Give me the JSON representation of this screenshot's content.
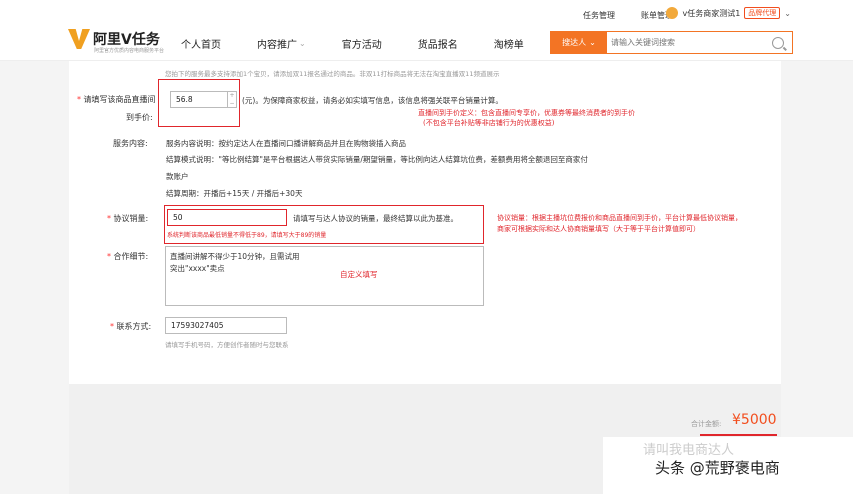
{
  "topbar": {
    "task_mgmt": "任务管理",
    "bill_mgmt": "账单管理",
    "user_name": "v任务商家测试1",
    "brand_badge": "品牌代理"
  },
  "logo": {
    "text": "阿里V任务",
    "sub": "阿里官方优质内容电商服务平台"
  },
  "nav": [
    "个人首页",
    "内容推广",
    "官方活动",
    "货品报名",
    "淘榜单"
  ],
  "search": {
    "select_label": "搜达人",
    "placeholder": "请输入关键词搜索"
  },
  "form": {
    "top_note": "您拍下的服务最多支持添加1个宝贝，请添加双11报名通过的商品。非双11打标商品将无法在淘宝直播双11频道展示",
    "price": {
      "label_line1": "请填写该商品直播间",
      "label_line2": "到手价:",
      "value": "56.8",
      "hint": "(元)。为保障商家权益，请务必如实填写信息，该信息将强关联平台销量计算。",
      "annotation_line1": "直播间到手价定义：包含直播间专享价，优惠券等最终消费者的到手价",
      "annotation_line2": "(不包含平台补贴等非店铺行为的优惠权益)"
    },
    "service": {
      "label": "服务内容:",
      "line1": "服务内容说明：按约定达人在直播间口播讲解商品并且在购物袋插入商品",
      "line2": "结算模式说明：\"等比例结算\"是平台根据达人带货实际销量/期望销量，等比例向达人结算坑位费，差额费用将全额退回至商家付",
      "line3": "款账户",
      "line4": "结算周期：开播后+15天 / 开播后+30天"
    },
    "sales": {
      "label": "协议销量:",
      "value": "50",
      "hint": "请填写与达人协议的销量，最终结算以此为基准。",
      "error": "系统判断该商品最低销量不得低于89，请填写大于89的销量",
      "annotation_line1": "协议销量：根据主播坑位费报价和商品直播间到手价，平台计算最低协议销量，",
      "annotation_line2": "商家可根据实际和达人协商销量填写（大于等于平台计算值即可）"
    },
    "coop": {
      "label": "合作细节:",
      "line1": "直播间讲解不得少于10分钟，且需试用",
      "line2": "突出\"xxxx\"卖点",
      "annotation": "自定义填写"
    },
    "contact": {
      "label": "联系方式:",
      "value": "17593027405",
      "hint": "请填写手机号码，方便创作者随时与您联系"
    }
  },
  "footer": {
    "total_label": "合计金额:",
    "total_value": "¥5000"
  },
  "watermark": {
    "line1": "请叫我电商达人",
    "line2": "头条 @荒野褒电商"
  },
  "colors": {
    "accent": "#f37424",
    "annotation_red": "#e0262c"
  }
}
